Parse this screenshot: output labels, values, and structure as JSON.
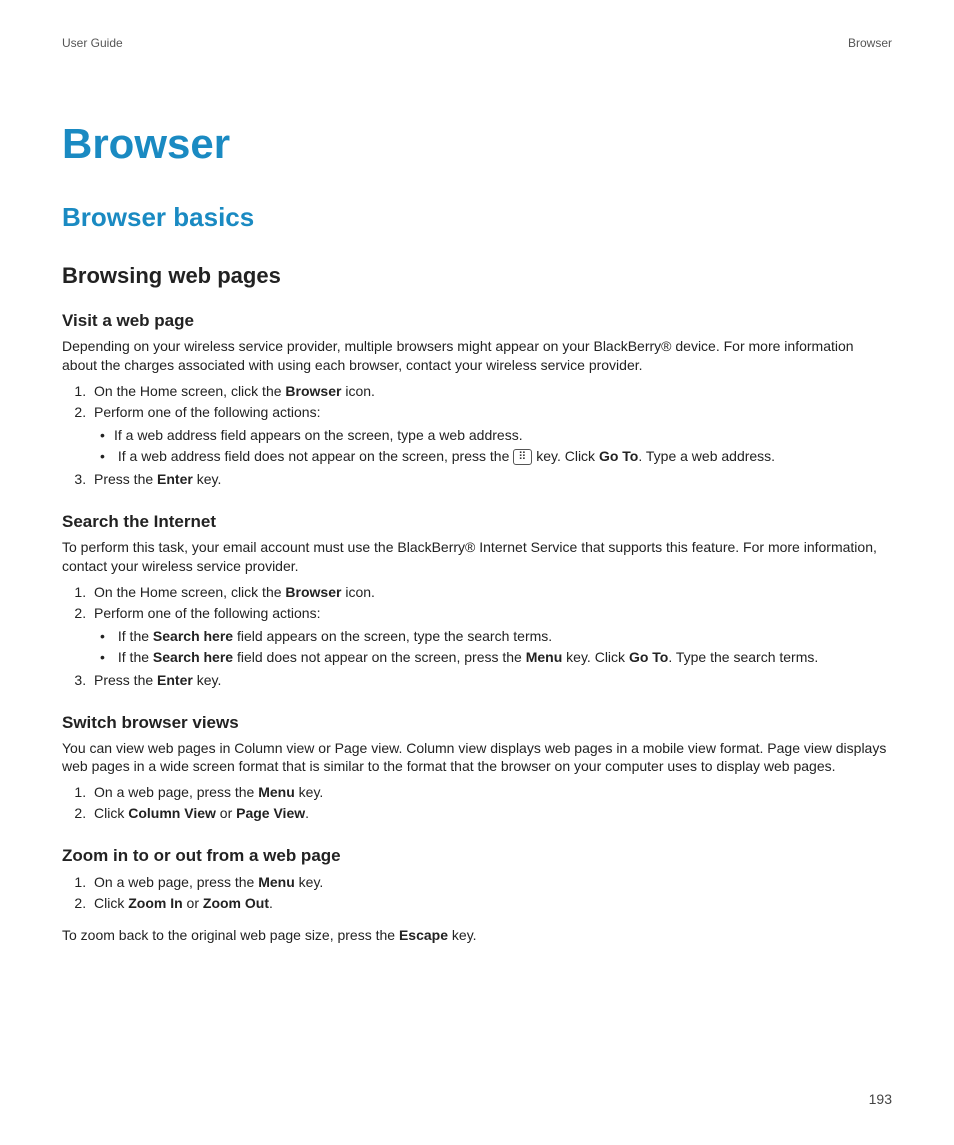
{
  "header": {
    "left": "User Guide",
    "right": "Browser"
  },
  "title": "Browser",
  "subtitle": "Browser basics",
  "section": "Browsing web pages",
  "visit": {
    "heading": "Visit a web page",
    "intro": "Depending on your wireless service provider, multiple browsers might appear on your BlackBerry® device. For more information about the charges associated with using each browser, contact your wireless service provider.",
    "s1a": "On the Home screen, click the ",
    "s1b": "Browser",
    "s1c": " icon.",
    "s2": "Perform one of the following actions:",
    "b1": "If a web address field appears on the screen, type a web address.",
    "b2a": "If a web address field does not appear on the screen, press the ",
    "b2b": " key. Click ",
    "b2c": "Go To",
    "b2d": ". Type a web address.",
    "s3a": "Press the ",
    "s3b": "Enter",
    "s3c": " key."
  },
  "search": {
    "heading": "Search the Internet",
    "intro": "To perform this task, your email account must use the BlackBerry® Internet Service that supports this feature. For more information, contact your wireless service provider.",
    "s1a": "On the Home screen, click the ",
    "s1b": "Browser",
    "s1c": " icon.",
    "s2": "Perform one of the following actions:",
    "b1a": "If the ",
    "b1b": "Search here",
    "b1c": " field appears on the screen, type the search terms.",
    "b2a": "If the ",
    "b2b": "Search here",
    "b2c": " field does not appear on the screen, press the ",
    "b2d": "Menu",
    "b2e": " key. Click ",
    "b2f": "Go To",
    "b2g": ". Type the search terms.",
    "s3a": "Press the ",
    "s3b": "Enter",
    "s3c": " key."
  },
  "switch": {
    "heading": "Switch browser views",
    "intro": "You can view web pages in Column view or Page view. Column view displays web pages in a mobile view format. Page view displays web pages in a wide screen format that is similar to the format that the browser on your computer uses to display web pages.",
    "s1a": "On a web page, press the ",
    "s1b": "Menu",
    "s1c": " key.",
    "s2a": "Click ",
    "s2b": "Column View",
    "s2c": " or ",
    "s2d": "Page View",
    "s2e": "."
  },
  "zoom": {
    "heading": "Zoom in to or out from a web page",
    "s1a": "On a web page, press the ",
    "s1b": "Menu",
    "s1c": " key.",
    "s2a": "Click ",
    "s2b": "Zoom In",
    "s2c": " or ",
    "s2d": "Zoom Out",
    "s2e": ".",
    "outroA": "To zoom back to the original web page size, press the ",
    "outroB": "Escape",
    "outroC": " key."
  },
  "keyGlyph": "⠿",
  "pageNumber": "193"
}
